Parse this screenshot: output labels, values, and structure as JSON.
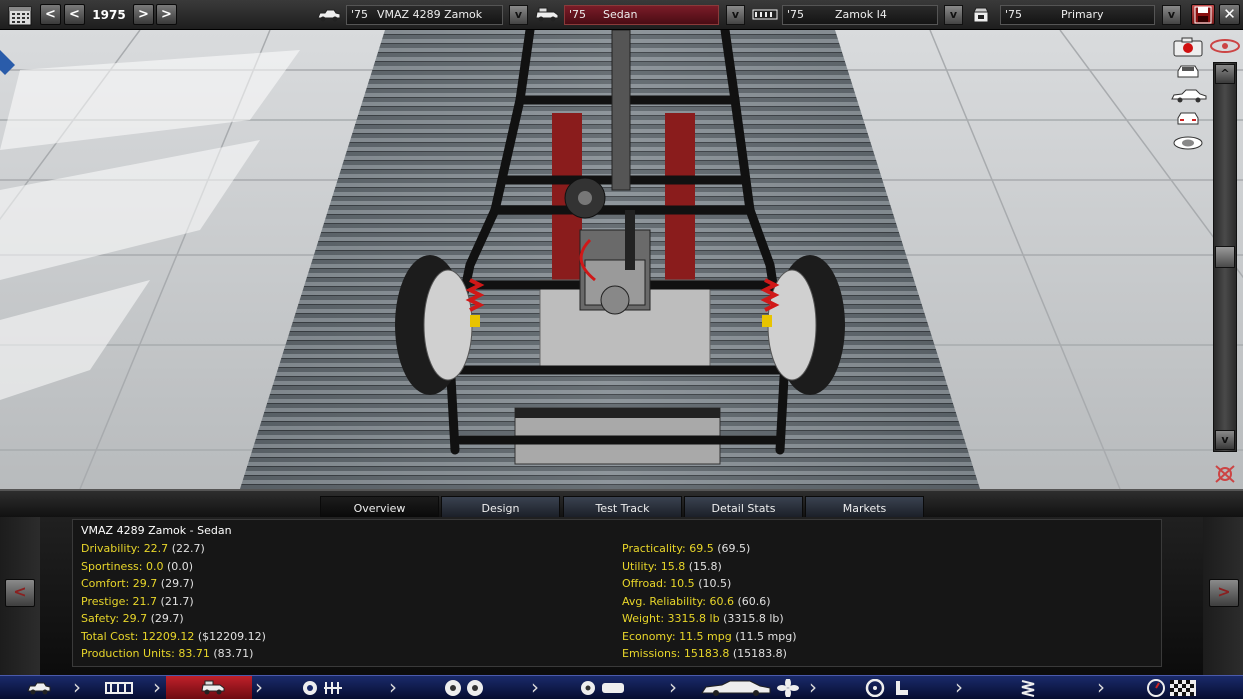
{
  "topbar": {
    "year": "1975",
    "prev_label": "<",
    "next_label": ">",
    "model": {
      "year": "'75",
      "name": "VMAZ 4289 Zamok"
    },
    "body": {
      "year": "'75",
      "name": "Sedan"
    },
    "engine": {
      "year": "'75",
      "name": "Zamok I4"
    },
    "trim": {
      "year": "'75",
      "name": "Primary"
    },
    "dropdown_label": "v"
  },
  "viewport": {
    "rail_up": "^",
    "rail_down": "v"
  },
  "tabs": [
    {
      "label": "Overview"
    },
    {
      "label": "Design"
    },
    {
      "label": "Test Track"
    },
    {
      "label": "Detail Stats"
    },
    {
      "label": "Markets"
    }
  ],
  "info": {
    "title": "VMAZ 4289 Zamok - Sedan",
    "left": [
      {
        "label": "Drivability:",
        "value": "22.7",
        "paren": "(22.7)"
      },
      {
        "label": "Sportiness:",
        "value": "0.0",
        "paren": "(0.0)"
      },
      {
        "label": "Comfort:",
        "value": "29.7",
        "paren": "(29.7)"
      },
      {
        "label": "Prestige:",
        "value": "21.7",
        "paren": "(21.7)"
      },
      {
        "label": "Safety:",
        "value": "29.7",
        "paren": "(29.7)"
      },
      {
        "label": "Total Cost:",
        "value": "12209.12",
        "paren": "($12209.12)"
      },
      {
        "label": "Production Units:",
        "value": "83.71",
        "paren": "(83.71)"
      }
    ],
    "right": [
      {
        "label": "Practicality:",
        "value": "69.5",
        "paren": "(69.5)"
      },
      {
        "label": "Utility:",
        "value": "15.8",
        "paren": "(15.8)"
      },
      {
        "label": "Offroad:",
        "value": "10.5",
        "paren": "(10.5)"
      },
      {
        "label": "Avg. Reliability:",
        "value": "60.6",
        "paren": "(60.6)"
      },
      {
        "label": "Weight:",
        "value": "3315.8 lb",
        "paren": "(3315.8 lb)"
      },
      {
        "label": "Economy:",
        "value": "11.5 mpg",
        "paren": "(11.5 mpg)"
      },
      {
        "label": "Emissions:",
        "value": "15183.8",
        "paren": "(15183.8)"
      }
    ],
    "prev_label": "<",
    "next_label": ">"
  },
  "colors": {
    "stat_highlight": "#e8d62a",
    "accent_red": "#c0202a",
    "nav_blue": "#1a2a6a"
  },
  "bottomnav": {
    "active_index": 2
  }
}
